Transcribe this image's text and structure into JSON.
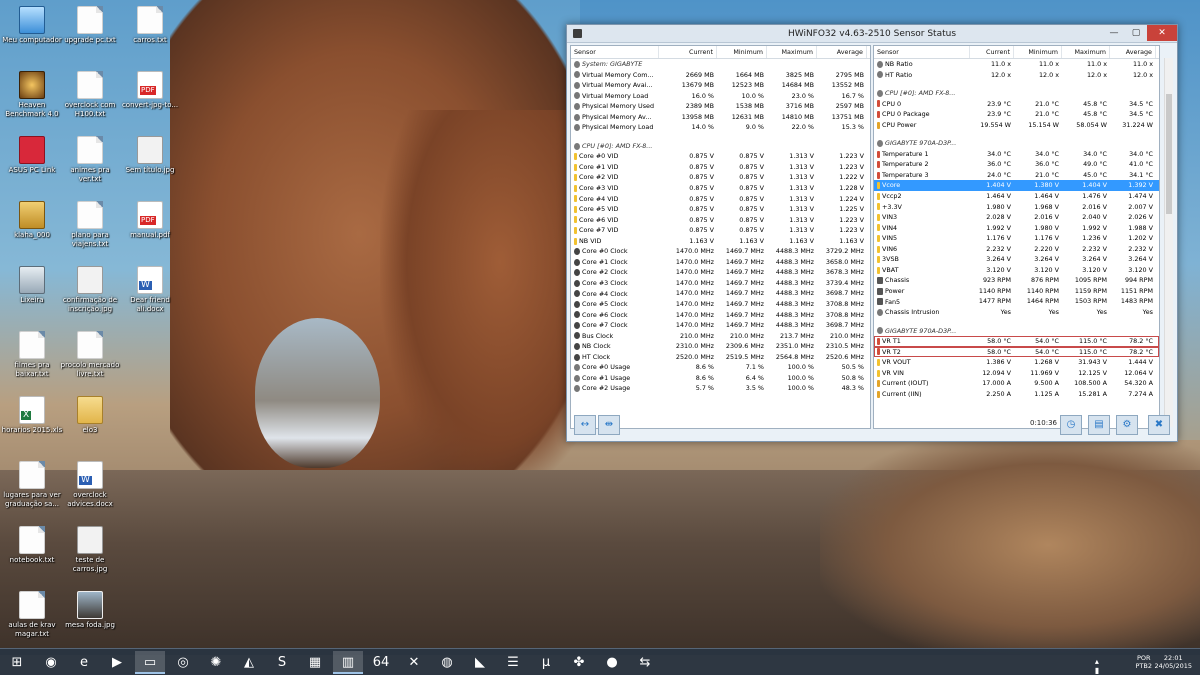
{
  "desktop_icons": [
    {
      "label": "Meu computador",
      "type": "pc",
      "x": 0
    },
    {
      "label": "upgrade pc.txt",
      "type": "file"
    },
    {
      "label": "carros.txt",
      "type": "file"
    },
    {
      "label": "Heaven Benchmark 4.0",
      "type": "heaven"
    },
    {
      "label": "overclock com H100.txt",
      "type": "file"
    },
    {
      "label": "convert-jpg-to...",
      "type": "pdf"
    },
    {
      "label": "ASUS PC Link",
      "type": "asus"
    },
    {
      "label": "animes pra ver.txt",
      "type": "file"
    },
    {
      "label": "Sem título.jpg",
      "type": "img"
    },
    {
      "label": "klaha_000",
      "type": "user"
    },
    {
      "label": "plano para viajens.txt",
      "type": "file"
    },
    {
      "label": "manual.pdf",
      "type": "pdf"
    },
    {
      "label": "Lixeira",
      "type": "bin"
    },
    {
      "label": "confirmação de inscrição.jpg",
      "type": "img"
    },
    {
      "label": "Dear friend ali.docx",
      "type": "word"
    },
    {
      "label": "filmes pra baixar.txt",
      "type": "file"
    },
    {
      "label": "procolo mercado livre.txt",
      "type": "file"
    },
    {
      "label": "horarios 2015.xls",
      "type": "excel"
    },
    {
      "label": "elo3",
      "type": "folder"
    },
    {
      "label": "lugares para ver graduação sa...",
      "type": "file"
    },
    {
      "label": "overclock advices.docx",
      "type": "word"
    },
    {
      "label": "notebook.txt",
      "type": "file"
    },
    {
      "label": "teste de carros.jpg",
      "type": "img"
    },
    {
      "label": "aulas de krav magar.txt",
      "type": "file"
    },
    {
      "label": "mesa foda.jpg",
      "type": "photo"
    }
  ],
  "window": {
    "title": "HWiNFO32 v4.63-2510 Sensor Status",
    "close": "✕",
    "minimize": "—",
    "maximize": "▢",
    "elapsed": "0:10:36"
  },
  "columns": {
    "sensor": "Sensor",
    "current": "Current",
    "minimum": "Minimum",
    "maximum": "Maximum",
    "average": "Average"
  },
  "left_rows": [
    {
      "kind": "group",
      "icon": "chip",
      "name": "System: GIGABYTE"
    },
    {
      "icon": "load",
      "name": "Virtual Memory Com...",
      "cur": "2669 MB",
      "min": "1664 MB",
      "max": "3825 MB",
      "avg": "2795 MB"
    },
    {
      "icon": "load",
      "name": "Virtual Memory Avai...",
      "cur": "13679 MB",
      "min": "12523 MB",
      "max": "14684 MB",
      "avg": "13552 MB"
    },
    {
      "icon": "load",
      "name": "Virtual Memory Load",
      "cur": "16.0 %",
      "min": "10.0 %",
      "max": "23.0 %",
      "avg": "16.7 %"
    },
    {
      "icon": "load",
      "name": "Physical Memory Used",
      "cur": "2389 MB",
      "min": "1538 MB",
      "max": "3716 MB",
      "avg": "2597 MB"
    },
    {
      "icon": "load",
      "name": "Physical Memory Av...",
      "cur": "13958 MB",
      "min": "12631 MB",
      "max": "14810 MB",
      "avg": "13751 MB"
    },
    {
      "icon": "load",
      "name": "Physical Memory Load",
      "cur": "14.0 %",
      "min": "9.0 %",
      "max": "22.0 %",
      "avg": "15.3 %"
    },
    {
      "kind": "blank"
    },
    {
      "kind": "group",
      "icon": "chip",
      "name": "CPU [#0]: AMD FX-8..."
    },
    {
      "icon": "volt",
      "name": "Core #0 VID",
      "cur": "0.875 V",
      "min": "0.875 V",
      "max": "1.313 V",
      "avg": "1.223 V"
    },
    {
      "icon": "volt",
      "name": "Core #1 VID",
      "cur": "0.875 V",
      "min": "0.875 V",
      "max": "1.313 V",
      "avg": "1.223 V"
    },
    {
      "icon": "volt",
      "name": "Core #2 VID",
      "cur": "0.875 V",
      "min": "0.875 V",
      "max": "1.313 V",
      "avg": "1.222 V"
    },
    {
      "icon": "volt",
      "name": "Core #3 VID",
      "cur": "0.875 V",
      "min": "0.875 V",
      "max": "1.313 V",
      "avg": "1.228 V"
    },
    {
      "icon": "volt",
      "name": "Core #4 VID",
      "cur": "0.875 V",
      "min": "0.875 V",
      "max": "1.313 V",
      "avg": "1.224 V"
    },
    {
      "icon": "volt",
      "name": "Core #5 VID",
      "cur": "0.875 V",
      "min": "0.875 V",
      "max": "1.313 V",
      "avg": "1.225 V"
    },
    {
      "icon": "volt",
      "name": "Core #6 VID",
      "cur": "0.875 V",
      "min": "0.875 V",
      "max": "1.313 V",
      "avg": "1.223 V"
    },
    {
      "icon": "volt",
      "name": "Core #7 VID",
      "cur": "0.875 V",
      "min": "0.875 V",
      "max": "1.313 V",
      "avg": "1.223 V"
    },
    {
      "icon": "volt",
      "name": "NB VID",
      "cur": "1.163 V",
      "min": "1.163 V",
      "max": "1.163 V",
      "avg": "1.163 V"
    },
    {
      "icon": "clock",
      "name": "Core #0 Clock",
      "cur": "1470.0 MHz",
      "min": "1469.7 MHz",
      "max": "4488.3 MHz",
      "avg": "3729.2 MHz"
    },
    {
      "icon": "clock",
      "name": "Core #1 Clock",
      "cur": "1470.0 MHz",
      "min": "1469.7 MHz",
      "max": "4488.3 MHz",
      "avg": "3658.0 MHz"
    },
    {
      "icon": "clock",
      "name": "Core #2 Clock",
      "cur": "1470.0 MHz",
      "min": "1469.7 MHz",
      "max": "4488.3 MHz",
      "avg": "3678.3 MHz"
    },
    {
      "icon": "clock",
      "name": "Core #3 Clock",
      "cur": "1470.0 MHz",
      "min": "1469.7 MHz",
      "max": "4488.3 MHz",
      "avg": "3739.4 MHz"
    },
    {
      "icon": "clock",
      "name": "Core #4 Clock",
      "cur": "1470.0 MHz",
      "min": "1469.7 MHz",
      "max": "4488.3 MHz",
      "avg": "3698.7 MHz"
    },
    {
      "icon": "clock",
      "name": "Core #5 Clock",
      "cur": "1470.0 MHz",
      "min": "1469.7 MHz",
      "max": "4488.3 MHz",
      "avg": "3708.8 MHz"
    },
    {
      "icon": "clock",
      "name": "Core #6 Clock",
      "cur": "1470.0 MHz",
      "min": "1469.7 MHz",
      "max": "4488.3 MHz",
      "avg": "3708.8 MHz"
    },
    {
      "icon": "clock",
      "name": "Core #7 Clock",
      "cur": "1470.0 MHz",
      "min": "1469.7 MHz",
      "max": "4488.3 MHz",
      "avg": "3698.7 MHz"
    },
    {
      "icon": "clock",
      "name": "Bus Clock",
      "cur": "210.0 MHz",
      "min": "210.0 MHz",
      "max": "213.7 MHz",
      "avg": "210.0 MHz"
    },
    {
      "icon": "clock",
      "name": "NB Clock",
      "cur": "2310.0 MHz",
      "min": "2309.6 MHz",
      "max": "2351.0 MHz",
      "avg": "2310.5 MHz"
    },
    {
      "icon": "clock",
      "name": "HT Clock",
      "cur": "2520.0 MHz",
      "min": "2519.5 MHz",
      "max": "2564.8 MHz",
      "avg": "2520.6 MHz"
    },
    {
      "icon": "load",
      "name": "Core #0 Usage",
      "cur": "8.6 %",
      "min": "7.1 %",
      "max": "100.0 %",
      "avg": "50.5 %"
    },
    {
      "icon": "load",
      "name": "Core #1 Usage",
      "cur": "8.6 %",
      "min": "6.4 %",
      "max": "100.0 %",
      "avg": "50.8 %"
    },
    {
      "icon": "load",
      "name": "Core #2 Usage",
      "cur": "5.7 %",
      "min": "3.5 %",
      "max": "100.0 %",
      "avg": "48.3 %"
    }
  ],
  "right_rows": [
    {
      "icon": "load",
      "name": "NB Ratio",
      "cur": "11.0 x",
      "min": "11.0 x",
      "max": "11.0 x",
      "avg": "11.0 x"
    },
    {
      "icon": "load",
      "name": "HT Ratio",
      "cur": "12.0 x",
      "min": "12.0 x",
      "max": "12.0 x",
      "avg": "12.0 x"
    },
    {
      "kind": "blank"
    },
    {
      "kind": "group",
      "icon": "chip",
      "name": "CPU [#0]: AMD FX-8..."
    },
    {
      "icon": "temp",
      "name": "CPU 0",
      "cur": "23.9 °C",
      "min": "21.0 °C",
      "max": "45.8 °C",
      "avg": "34.5 °C"
    },
    {
      "icon": "temp",
      "name": "CPU 0 Package",
      "cur": "23.9 °C",
      "min": "21.0 °C",
      "max": "45.8 °C",
      "avg": "34.5 °C"
    },
    {
      "icon": "power",
      "name": "CPU Power",
      "cur": "19.554 W",
      "min": "15.154 W",
      "max": "58.054 W",
      "avg": "31.224 W"
    },
    {
      "kind": "blank"
    },
    {
      "kind": "group",
      "icon": "chip",
      "name": "GIGABYTE 970A-D3P..."
    },
    {
      "icon": "temp",
      "name": "Temperature 1",
      "cur": "34.0 °C",
      "min": "34.0 °C",
      "max": "34.0 °C",
      "avg": "34.0 °C"
    },
    {
      "icon": "temp",
      "name": "Temperature 2",
      "cur": "36.0 °C",
      "min": "36.0 °C",
      "max": "49.0 °C",
      "avg": "41.0 °C"
    },
    {
      "icon": "temp",
      "name": "Temperature 3",
      "cur": "24.0 °C",
      "min": "21.0 °C",
      "max": "45.0 °C",
      "avg": "34.1 °C"
    },
    {
      "icon": "volt",
      "name": "Vcore",
      "cur": "1.404 V",
      "min": "1.380 V",
      "max": "1.404 V",
      "avg": "1.392 V",
      "selected": true
    },
    {
      "icon": "volt",
      "name": "Vccp2",
      "cur": "1.464 V",
      "min": "1.464 V",
      "max": "1.476 V",
      "avg": "1.474 V"
    },
    {
      "icon": "volt",
      "name": "+3.3V",
      "cur": "1.980 V",
      "min": "1.968 V",
      "max": "2.016 V",
      "avg": "2.007 V"
    },
    {
      "icon": "volt",
      "name": "VIN3",
      "cur": "2.028 V",
      "min": "2.016 V",
      "max": "2.040 V",
      "avg": "2.026 V"
    },
    {
      "icon": "volt",
      "name": "VIN4",
      "cur": "1.992 V",
      "min": "1.980 V",
      "max": "1.992 V",
      "avg": "1.988 V"
    },
    {
      "icon": "volt",
      "name": "VIN5",
      "cur": "1.176 V",
      "min": "1.176 V",
      "max": "1.236 V",
      "avg": "1.202 V"
    },
    {
      "icon": "volt",
      "name": "VIN6",
      "cur": "2.232 V",
      "min": "2.220 V",
      "max": "2.232 V",
      "avg": "2.232 V"
    },
    {
      "icon": "volt",
      "name": "3VSB",
      "cur": "3.264 V",
      "min": "3.264 V",
      "max": "3.264 V",
      "avg": "3.264 V"
    },
    {
      "icon": "volt",
      "name": "VBAT",
      "cur": "3.120 V",
      "min": "3.120 V",
      "max": "3.120 V",
      "avg": "3.120 V"
    },
    {
      "icon": "fan",
      "name": "Chassis",
      "cur": "923 RPM",
      "min": "876 RPM",
      "max": "1095 RPM",
      "avg": "994 RPM"
    },
    {
      "icon": "fan",
      "name": "Power",
      "cur": "1140 RPM",
      "min": "1140 RPM",
      "max": "1159 RPM",
      "avg": "1151 RPM"
    },
    {
      "icon": "fan",
      "name": "Fan5",
      "cur": "1477 RPM",
      "min": "1464 RPM",
      "max": "1503 RPM",
      "avg": "1483 RPM"
    },
    {
      "icon": "load",
      "name": "Chassis Intrusion",
      "cur": "Yes",
      "min": "Yes",
      "max": "Yes",
      "avg": "Yes"
    },
    {
      "kind": "blank"
    },
    {
      "kind": "group",
      "icon": "chip",
      "name": "GIGABYTE 970A-D3P..."
    },
    {
      "icon": "temp",
      "name": "VR T1",
      "cur": "58.0 °C",
      "min": "54.0 °C",
      "max": "115.0 °C",
      "avg": "78.2 °C",
      "alarm": true
    },
    {
      "icon": "temp",
      "name": "VR T2",
      "cur": "58.0 °C",
      "min": "54.0 °C",
      "max": "115.0 °C",
      "avg": "78.2 °C",
      "alarm": true
    },
    {
      "icon": "volt",
      "name": "VR VOUT",
      "cur": "1.386 V",
      "min": "1.268 V",
      "max": "31.943 V",
      "avg": "1.444 V"
    },
    {
      "icon": "volt",
      "name": "VR VIN",
      "cur": "12.094 V",
      "min": "11.969 V",
      "max": "12.125 V",
      "avg": "12.064 V"
    },
    {
      "icon": "power",
      "name": "Current (IOUT)",
      "cur": "17.000 A",
      "min": "9.500 A",
      "max": "108.500 A",
      "avg": "54.320 A"
    },
    {
      "icon": "power",
      "name": "Current (IIN)",
      "cur": "2.250 A",
      "min": "1.125 A",
      "max": "15.281 A",
      "avg": "7.274 A"
    }
  ],
  "footer_buttons": [
    {
      "name": "expand-button",
      "glyph": "↔"
    },
    {
      "name": "collapse-button",
      "glyph": "⇹"
    },
    {
      "name": "clock-button",
      "glyph": "◷"
    },
    {
      "name": "log-button",
      "glyph": "▤"
    },
    {
      "name": "settings-button",
      "glyph": "⚙"
    },
    {
      "name": "close-sensors-button",
      "glyph": "✖"
    }
  ],
  "taskbar": {
    "start": "⊞",
    "apps": [
      {
        "name": "chrome",
        "glyph": "◉"
      },
      {
        "name": "ie",
        "glyph": "e"
      },
      {
        "name": "media",
        "glyph": "▶"
      },
      {
        "name": "explorer",
        "glyph": "▭"
      },
      {
        "name": "steam",
        "glyph": "◎"
      },
      {
        "name": "app6",
        "glyph": "✺"
      },
      {
        "name": "app7",
        "glyph": "◭"
      },
      {
        "name": "skype",
        "glyph": "S"
      },
      {
        "name": "film",
        "glyph": "▦"
      },
      {
        "name": "hwinfo",
        "glyph": "▥"
      },
      {
        "name": "aida64",
        "glyph": "64"
      },
      {
        "name": "xbox",
        "glyph": "✕"
      },
      {
        "name": "app13",
        "glyph": "◍"
      },
      {
        "name": "matlab",
        "glyph": "◣"
      },
      {
        "name": "app15",
        "glyph": "☰"
      },
      {
        "name": "utorrent",
        "glyph": "µ"
      },
      {
        "name": "app17",
        "glyph": "✤"
      },
      {
        "name": "record",
        "glyph": "●"
      },
      {
        "name": "teamviewer",
        "glyph": "⇆"
      }
    ],
    "lang_top": "POR",
    "lang_bottom": "PTB2",
    "time": "22:01",
    "date": "24/05/2015",
    "tray_icons": "▴ ▮ ⚑ ▯ ◂)"
  }
}
